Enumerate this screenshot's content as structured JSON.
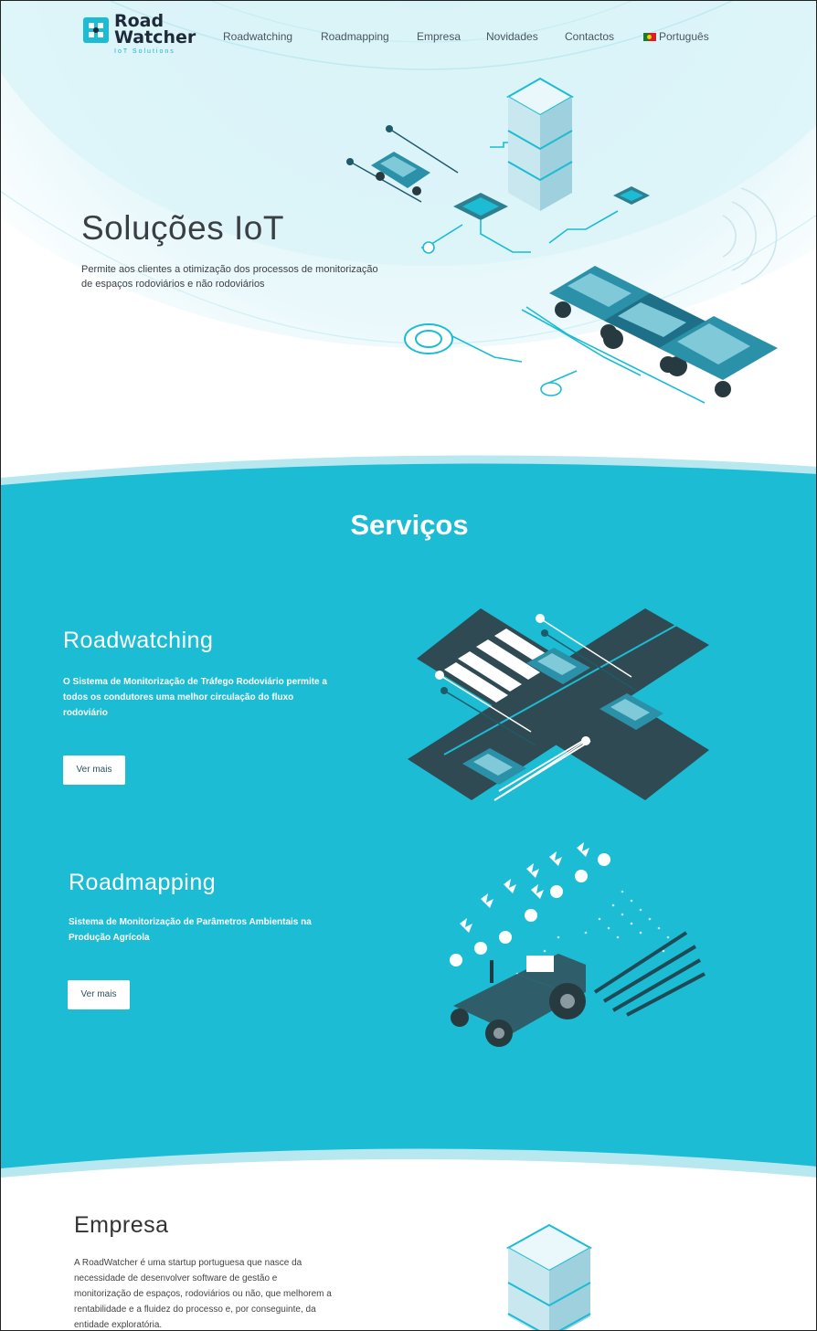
{
  "brand": {
    "name_line1": "Road",
    "name_line2": "Watcher",
    "tagline": "IoT Solutions"
  },
  "nav": {
    "items": [
      "Roadwatching",
      "Roadmapping",
      "Empresa",
      "Novidades",
      "Contactos"
    ],
    "language": "Português"
  },
  "hero": {
    "title": "Soluções IoT",
    "text": "Permite aos clientes a otimização dos processos de monitorização de espaços rodoviários e não rodoviários"
  },
  "services": {
    "title": "Serviços",
    "items": [
      {
        "heading": "Roadwatching",
        "text": "O Sistema de Monitorização de Tráfego Rodoviário permite a todos os condutores uma melhor circulação do fluxo rodoviário",
        "button": "Ver mais"
      },
      {
        "heading": "Roadmapping",
        "text": "Sistema de Monitorização de Parâmetros Ambientais na Produção Agrícola",
        "button": "Ver mais"
      }
    ]
  },
  "empresa": {
    "heading": "Empresa",
    "text": "A RoadWatcher é uma startup portuguesa que nasce da necessidade de desenvolver software de gestão e monitorização de espaços, rodoviários ou não, que melhorem a rentabilidade e a fluidez do processo e, por conseguinte, da entidade exploratória."
  },
  "colors": {
    "accent": "#1bbcd4",
    "dark": "#2e4a55",
    "hero_bg": "#e4f6fa"
  }
}
